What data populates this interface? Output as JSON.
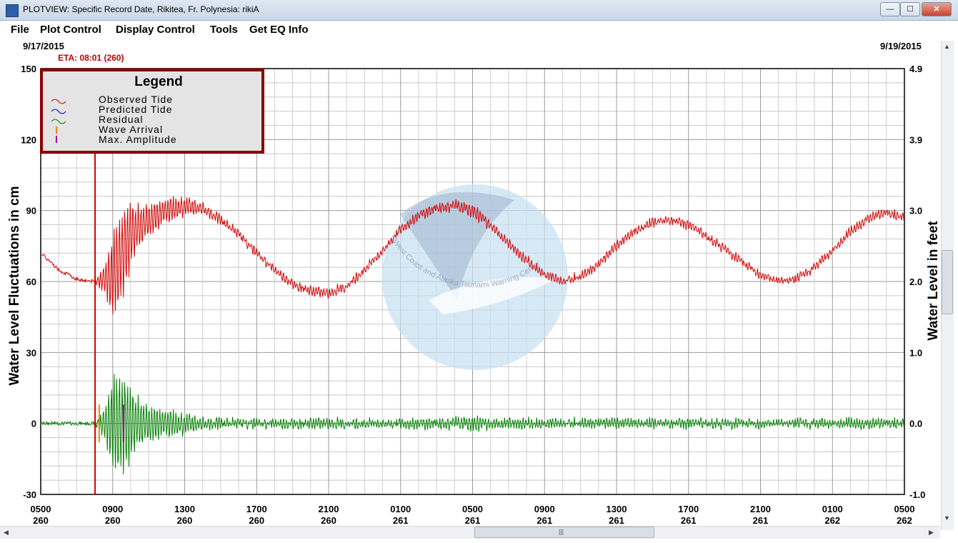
{
  "window": {
    "title": "PLOTVIEW: Specific Record Date, Rikitea, Fr. Polynesia: rikiA",
    "minimize_label": "—",
    "maximize_label": "☐",
    "close_label": "✕"
  },
  "menu": [
    "File",
    "Plot Control",
    "Display Control",
    "Tools",
    "Get EQ Info"
  ],
  "plot": {
    "date_start": "9/17/2015",
    "date_end": "9/19/2015",
    "eta_label": "ETA: 08:01 (260)",
    "y_left_label": "Water Level Fluctuations in cm",
    "y_right_label": "Water Level in feet",
    "watermark": "West Coast and Alaska Tsunami Warning Center",
    "colors": {
      "observed": "#d40000",
      "predicted": "#0000cc",
      "residual": "#008000",
      "wave_arrival": "#ff8000",
      "max_amplitude": "#a000a0",
      "eta_line": "#d40000",
      "legend_border": "#8b0000"
    }
  },
  "legend": {
    "title": "Legend",
    "items": [
      "Observed Tide",
      "Predicted Tide",
      "Residual",
      "Wave Arrival",
      "Max. Amplitude"
    ]
  },
  "chart_data": {
    "type": "line",
    "y_left_ticks": [
      "150",
      "120",
      "90",
      "60",
      "30",
      "0",
      "-30"
    ],
    "y_right_ticks": [
      "4.9",
      "3.9",
      "3.0",
      "2.0",
      "1.0",
      "0.0",
      "-1.0"
    ],
    "ylim_cm": [
      -30,
      150
    ],
    "x_ticks": [
      {
        "time": "0500",
        "day": "260"
      },
      {
        "time": "0900",
        "day": "260"
      },
      {
        "time": "1300",
        "day": "260"
      },
      {
        "time": "1700",
        "day": "260"
      },
      {
        "time": "2100",
        "day": "260"
      },
      {
        "time": "0100",
        "day": "261"
      },
      {
        "time": "0500",
        "day": "261"
      },
      {
        "time": "0900",
        "day": "261"
      },
      {
        "time": "1300",
        "day": "261"
      },
      {
        "time": "1700",
        "day": "261"
      },
      {
        "time": "2100",
        "day": "261"
      },
      {
        "time": "0100",
        "day": "262"
      },
      {
        "time": "0500",
        "day": "262"
      }
    ],
    "xlim_hours": [
      0,
      48
    ],
    "eta_hour": 3.02,
    "wave_arrival_hour": 3.25,
    "max_amplitude_hour": 4.6,
    "series": [
      {
        "name": "Observed Tide",
        "x": [
          0,
          1,
          2,
          3,
          4,
          5,
          6,
          7,
          8,
          9,
          10,
          11,
          12,
          13,
          14,
          15,
          16,
          17,
          18,
          19,
          20,
          21,
          22,
          23,
          24,
          25,
          26,
          27,
          28,
          29,
          30,
          31,
          32,
          33,
          34,
          35,
          36,
          37,
          38,
          39,
          40,
          41,
          42,
          43,
          44,
          45,
          46,
          47,
          48
        ],
        "values": [
          72,
          65,
          61,
          60,
          62,
          80,
          86,
          90,
          92,
          91,
          86,
          80,
          72,
          65,
          59,
          56,
          55,
          58,
          65,
          73,
          82,
          88,
          91,
          92,
          90,
          84,
          76,
          69,
          63,
          60,
          62,
          67,
          75,
          81,
          85,
          86,
          84,
          79,
          74,
          68,
          63,
          60,
          61,
          66,
          73,
          81,
          87,
          89,
          87
        ]
      },
      {
        "name": "Residual",
        "x": [
          0,
          1,
          2,
          3,
          3.5,
          4,
          4.5,
          5,
          5.5,
          6,
          7,
          8,
          9,
          10,
          12,
          16,
          20,
          24,
          28,
          32,
          36,
          40,
          44,
          48
        ],
        "values": [
          0,
          0,
          0,
          0,
          8,
          22,
          28,
          18,
          12,
          10,
          7,
          5,
          3,
          2,
          2,
          2,
          2,
          3,
          2,
          2,
          2,
          2,
          2,
          2
        ]
      }
    ]
  }
}
